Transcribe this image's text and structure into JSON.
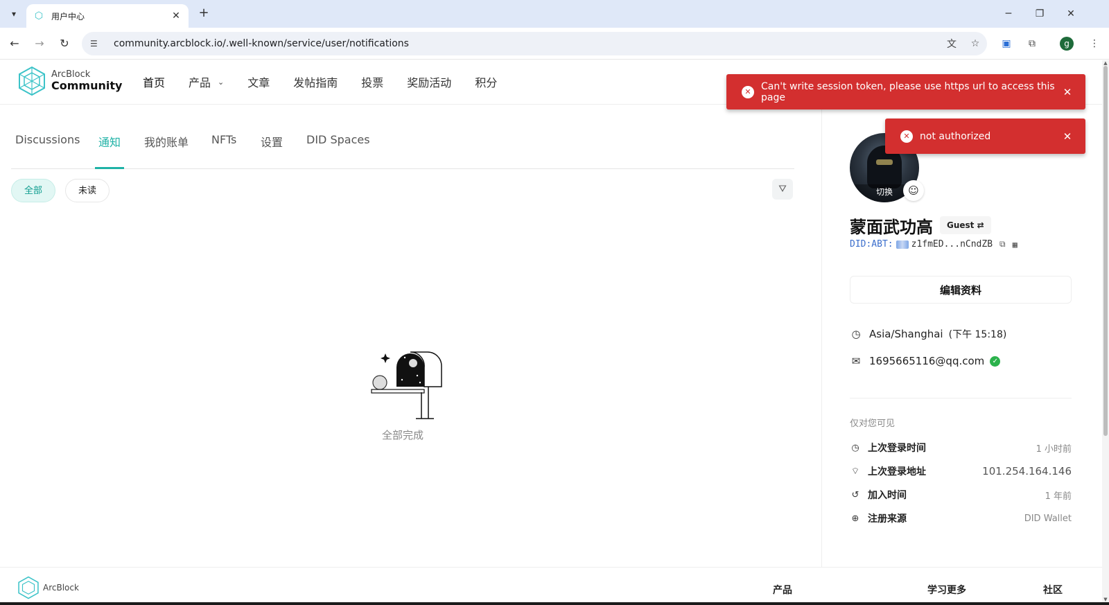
{
  "browser": {
    "tab_title": "用户中心",
    "url": "community.arcblock.io/.well-known/service/user/notifications",
    "profile_initial": "g"
  },
  "header": {
    "logo_line1": "ArcBlock",
    "logo_line2": "Community",
    "nav": [
      "首页",
      "产品",
      "文章",
      "发帖指南",
      "投票",
      "奖励活动",
      "积分"
    ]
  },
  "tabs": [
    "Discussions",
    "通知",
    "我的账单",
    "NFTs",
    "设置",
    "DID Spaces"
  ],
  "active_tab": "通知",
  "filters": {
    "all": "全部",
    "unread": "未读"
  },
  "empty_state": "全部完成",
  "profile": {
    "avatar_overlay": "切换",
    "name": "蒙面武功高",
    "role": "Guest ⇄",
    "did_prefix": "DID:ABT:",
    "did_value": "z1fmED...nCndZB",
    "edit_button": "编辑资料",
    "timezone": "Asia/Shanghai",
    "local_time": "(下午 15:18)",
    "email": "1695665116@qq.com",
    "private_label": "仅对您可见",
    "meta": [
      {
        "label": "上次登录时间",
        "value": "1 小时前"
      },
      {
        "label": "上次登录地址",
        "value": "101.254.164.146"
      },
      {
        "label": "加入时间",
        "value": "1 年前"
      },
      {
        "label": "注册来源",
        "value": "DID Wallet"
      }
    ]
  },
  "toasts": [
    "Can't write session token, please use https url to access this page",
    "not authorized"
  ],
  "footer": {
    "logo": "ArcBlock",
    "columns": [
      "产品",
      "学习更多",
      "社区"
    ]
  },
  "colors": {
    "accent": "#1fb2a6",
    "error": "#d32f2f",
    "verified": "#2bb24c"
  }
}
